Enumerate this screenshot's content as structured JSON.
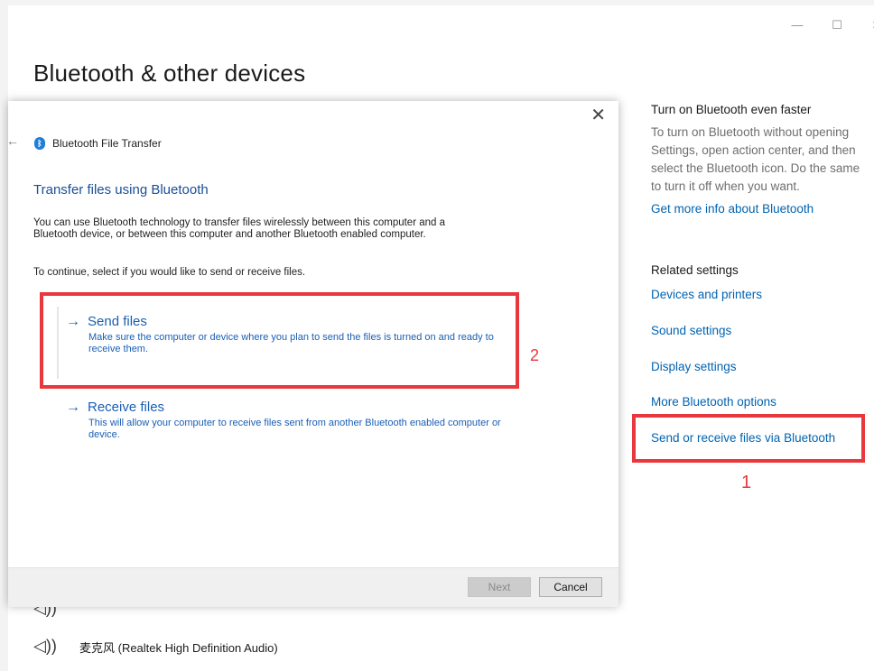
{
  "window": {
    "min_glyph": "—",
    "max_glyph": "☐",
    "close_glyph": "✕"
  },
  "page": {
    "title": "Bluetooth & other devices"
  },
  "right_pane": {
    "tip_heading": "Turn on Bluetooth even faster",
    "tip_body": "To turn on Bluetooth without opening Settings, open action center, and then select the Bluetooth icon. Do the same to turn it off when you want.",
    "more_info_link": "Get more info about Bluetooth",
    "related_heading": "Related settings",
    "links": [
      "Devices and printers",
      "Sound settings",
      "Display settings",
      "More Bluetooth options",
      "Send or receive files via Bluetooth"
    ]
  },
  "annotations": {
    "mark_1": "1",
    "mark_2": "2",
    "color": "#e8383d"
  },
  "devices": {
    "icon_glyph": "◁))",
    "microphone_label": "麦克风 (Realtek High Definition Audio)"
  },
  "dialog": {
    "app_title": "Bluetooth File Transfer",
    "heading": "Transfer files using Bluetooth",
    "description": "You can use Bluetooth technology to transfer files wirelessly between this computer and a Bluetooth device, or between this computer and another Bluetooth enabled computer.",
    "prompt": "To continue, select if you would like to send or receive files.",
    "options": [
      {
        "title": "Send files",
        "description": "Make sure the computer or device where you plan to send the files is turned on and ready to receive them."
      },
      {
        "title": "Receive files",
        "description": "This will allow your computer to receive files sent from another Bluetooth enabled computer or device."
      }
    ],
    "next_label": "Next",
    "cancel_label": "Cancel",
    "close_glyph": "✕",
    "back_glyph": "←",
    "arrow_glyph": "→",
    "bt_glyph": "ᛒ"
  },
  "colors": {
    "link": "#0063b1",
    "dialog_link": "#1a5fb4",
    "annotation": "#e8383d"
  }
}
